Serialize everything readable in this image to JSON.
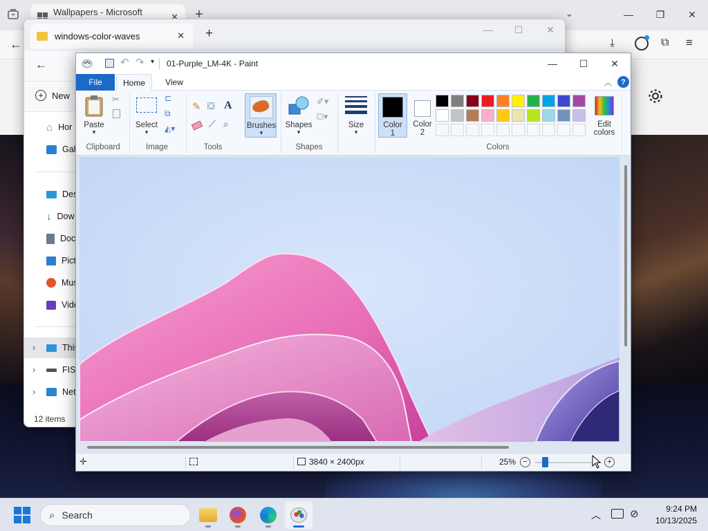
{
  "browser": {
    "tab_title": "Wallpapers - Microsoft Design",
    "new_tab": "+",
    "icons": [
      "tab-actions-icon",
      "back-icon",
      "downloads-icon",
      "profile-icon",
      "extensions-icon",
      "menu-icon",
      "settings-gear-icon"
    ]
  },
  "explorer": {
    "tab_title": "windows-color-waves",
    "new_tab": "+",
    "new_button": "New",
    "sidebar": {
      "items": [
        {
          "label": "Hor",
          "icon": "home-icon"
        },
        {
          "label": "Gall",
          "icon": "gallery-icon"
        },
        {
          "label": "Desl",
          "icon": "desktop-icon"
        },
        {
          "label": "Dow",
          "icon": "download-icon"
        },
        {
          "label": "Doc",
          "icon": "documents-icon"
        },
        {
          "label": "Pict",
          "icon": "pictures-icon"
        },
        {
          "label": "Mus",
          "icon": "music-icon"
        },
        {
          "label": "Vide",
          "icon": "videos-icon"
        },
        {
          "label": "This",
          "icon": "this-pc-icon"
        },
        {
          "label": "FIS-",
          "icon": "drive-icon"
        },
        {
          "label": "Netv",
          "icon": "network-icon"
        }
      ]
    },
    "status": "12 items"
  },
  "paint": {
    "title": "01-Purple_LM-4K - Paint",
    "tabs": {
      "file": "File",
      "home": "Home",
      "view": "View"
    },
    "groups": {
      "clipboard": "Clipboard",
      "image": "Image",
      "tools": "Tools",
      "shapes": "Shapes",
      "colors": "Colors"
    },
    "buttons": {
      "paste": "Paste",
      "select": "Select",
      "brushes": "Brushes",
      "shapes": "Shapes",
      "size": "Size",
      "color1_line1": "Color",
      "color1_line2": "1",
      "color2_line1": "Color",
      "color2_line2": "2",
      "edit_colors_line1": "Edit",
      "edit_colors_line2": "colors"
    },
    "color1": "#000000",
    "color2": "#ffffff",
    "palette_row1": [
      "#000000",
      "#7f7f7f",
      "#880015",
      "#ed1c24",
      "#ff7f27",
      "#fff200",
      "#22b14c",
      "#00a2e8",
      "#3f48cc",
      "#a349a4"
    ],
    "palette_row2": [
      "#ffffff",
      "#c3c3c3",
      "#b97a57",
      "#ffaec9",
      "#ffc90e",
      "#efe4b0",
      "#b5e61d",
      "#99d9ea",
      "#7092be",
      "#c8bfe7"
    ],
    "status": {
      "image_size": "3840 × 2400px",
      "zoom": "25%"
    }
  },
  "taskbar": {
    "search_placeholder": "Search",
    "time": "9:24 PM",
    "date": "10/13/2025"
  }
}
